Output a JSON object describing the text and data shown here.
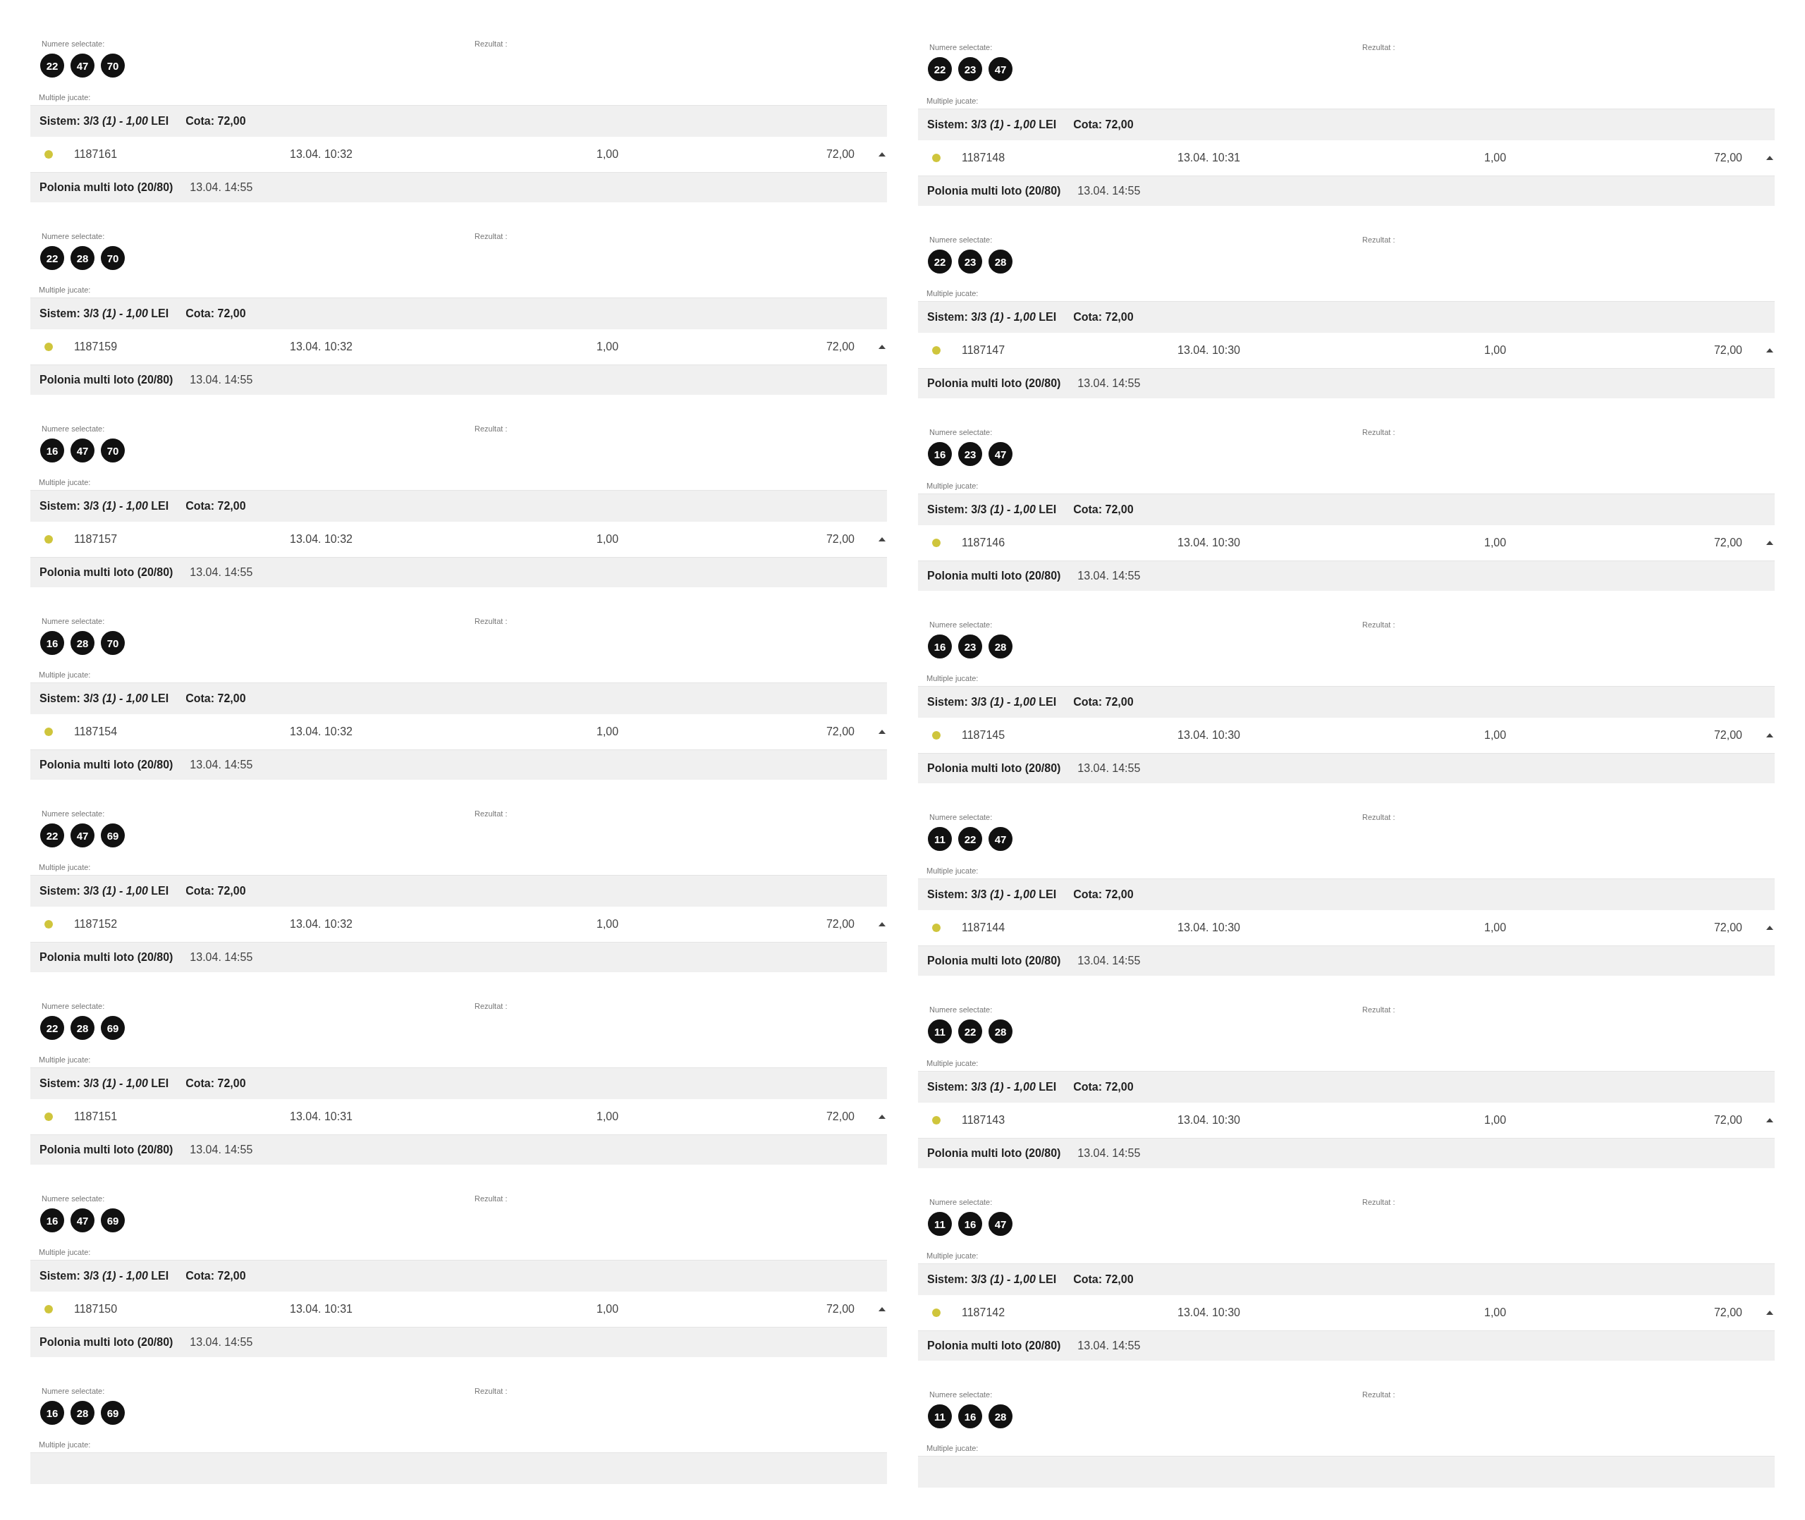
{
  "columns": [
    {
      "tickets": [
        {
          "kind": "full",
          "numbers_label": "Numere selectate:",
          "result_label": "Rezultat :",
          "numbers": [
            "22",
            "47",
            "70"
          ],
          "multiples_label": "Multiple jucate:",
          "system": "Sistem: 3/3 *(1) - 1,00* LEI",
          "odds": "Cota: 72,00",
          "id": "1187161",
          "placed": "13.04. 10:32",
          "stake": "1,00",
          "payout": "72,00",
          "expanded": true,
          "game": "Polonia multi loto (20/80)",
          "draw_time": "13.04. 14:55"
        },
        {
          "kind": "full",
          "numbers_label": "Numere selectate:",
          "result_label": "Rezultat :",
          "numbers": [
            "22",
            "28",
            "70"
          ],
          "multiples_label": "Multiple jucate:",
          "system": "Sistem: 3/3 *(1) - 1,00* LEI",
          "odds": "Cota: 72,00",
          "id": "1187159",
          "placed": "13.04. 10:32",
          "stake": "1,00",
          "payout": "72,00",
          "expanded": true,
          "game": "Polonia multi loto (20/80)",
          "draw_time": "13.04. 14:55"
        },
        {
          "kind": "full",
          "numbers_label": "Numere selectate:",
          "result_label": "Rezultat :",
          "numbers": [
            "16",
            "47",
            "70"
          ],
          "multiples_label": "Multiple jucate:",
          "system": "Sistem: 3/3 *(1) - 1,00* LEI",
          "odds": "Cota: 72,00",
          "id": "1187157",
          "placed": "13.04. 10:32",
          "stake": "1,00",
          "payout": "72,00",
          "expanded": true,
          "game": "Polonia multi loto (20/80)",
          "draw_time": "13.04. 14:55"
        },
        {
          "kind": "full",
          "numbers_label": "Numere selectate:",
          "result_label": "Rezultat :",
          "numbers": [
            "16",
            "28",
            "70"
          ],
          "multiples_label": "Multiple jucate:",
          "system": "Sistem: 3/3 *(1) - 1,00* LEI",
          "odds": "Cota: 72,00",
          "id": "1187154",
          "placed": "13.04. 10:32",
          "stake": "1,00",
          "payout": "72,00",
          "expanded": true,
          "game": "Polonia multi loto (20/80)",
          "draw_time": "13.04. 14:55"
        },
        {
          "kind": "full",
          "numbers_label": "Numere selectate:",
          "result_label": "Rezultat :",
          "numbers": [
            "22",
            "47",
            "69"
          ],
          "multiples_label": "Multiple jucate:",
          "system": "Sistem: 3/3 *(1) - 1,00* LEI",
          "odds": "Cota: 72,00",
          "id": "1187152",
          "placed": "13.04. 10:32",
          "stake": "1,00",
          "payout": "72,00",
          "expanded": true,
          "game": "Polonia multi loto (20/80)",
          "draw_time": "13.04. 14:55"
        },
        {
          "kind": "full",
          "numbers_label": "Numere selectate:",
          "result_label": "Rezultat :",
          "numbers": [
            "22",
            "28",
            "69"
          ],
          "multiples_label": "Multiple jucate:",
          "system": "Sistem: 3/3 *(1) - 1,00* LEI",
          "odds": "Cota: 72,00",
          "id": "1187151",
          "placed": "13.04. 10:31",
          "stake": "1,00",
          "payout": "72,00",
          "expanded": true,
          "game": "Polonia multi loto (20/80)",
          "draw_time": "13.04. 14:55"
        },
        {
          "kind": "full",
          "numbers_label": "Numere selectate:",
          "result_label": "Rezultat :",
          "numbers": [
            "16",
            "47",
            "69"
          ],
          "multiples_label": "Multiple jucate:",
          "system": "Sistem: 3/3 *(1) - 1,00* LEI",
          "odds": "Cota: 72,00",
          "id": "1187150",
          "placed": "13.04. 10:31",
          "stake": "1,00",
          "payout": "72,00",
          "expanded": true,
          "game": "Polonia multi loto (20/80)",
          "draw_time": "13.04. 14:55"
        },
        {
          "kind": "partial",
          "numbers_label": "Numere selectate:",
          "result_label": "Rezultat :",
          "numbers": [
            "16",
            "28",
            "69"
          ],
          "multiples_label": "Multiple jucate:"
        }
      ]
    },
    {
      "tickets": [
        {
          "kind": "full",
          "numbers_label": "Numere selectate:",
          "result_label": "Rezultat :",
          "numbers": [
            "22",
            "23",
            "47"
          ],
          "multiples_label": "Multiple jucate:",
          "system": "Sistem: 3/3 *(1) - 1,00* LEI",
          "odds": "Cota: 72,00",
          "id": "1187148",
          "placed": "13.04. 10:31",
          "stake": "1,00",
          "payout": "72,00",
          "expanded": true,
          "game": "Polonia multi loto (20/80)",
          "draw_time": "13.04. 14:55"
        },
        {
          "kind": "full",
          "numbers_label": "Numere selectate:",
          "result_label": "Rezultat :",
          "numbers": [
            "22",
            "23",
            "28"
          ],
          "multiples_label": "Multiple jucate:",
          "system": "Sistem: 3/3 *(1) - 1,00* LEI",
          "odds": "Cota: 72,00",
          "id": "1187147",
          "placed": "13.04. 10:30",
          "stake": "1,00",
          "payout": "72,00",
          "expanded": true,
          "game": "Polonia multi loto (20/80)",
          "draw_time": "13.04. 14:55"
        },
        {
          "kind": "full",
          "numbers_label": "Numere selectate:",
          "result_label": "Rezultat :",
          "numbers": [
            "16",
            "23",
            "47"
          ],
          "multiples_label": "Multiple jucate:",
          "system": "Sistem: 3/3 *(1) - 1,00* LEI",
          "odds": "Cota: 72,00",
          "id": "1187146",
          "placed": "13.04. 10:30",
          "stake": "1,00",
          "payout": "72,00",
          "expanded": true,
          "game": "Polonia multi loto (20/80)",
          "draw_time": "13.04. 14:55"
        },
        {
          "kind": "full",
          "numbers_label": "Numere selectate:",
          "result_label": "Rezultat :",
          "numbers": [
            "16",
            "23",
            "28"
          ],
          "multiples_label": "Multiple jucate:",
          "system": "Sistem: 3/3 *(1) - 1,00* LEI",
          "odds": "Cota: 72,00",
          "id": "1187145",
          "placed": "13.04. 10:30",
          "stake": "1,00",
          "payout": "72,00",
          "expanded": true,
          "game": "Polonia multi loto (20/80)",
          "draw_time": "13.04. 14:55"
        },
        {
          "kind": "full",
          "numbers_label": "Numere selectate:",
          "result_label": "Rezultat :",
          "numbers": [
            "11",
            "22",
            "47"
          ],
          "multiples_label": "Multiple jucate:",
          "system": "Sistem: 3/3 *(1) - 1,00* LEI",
          "odds": "Cota: 72,00",
          "id": "1187144",
          "placed": "13.04. 10:30",
          "stake": "1,00",
          "payout": "72,00",
          "expanded": true,
          "game": "Polonia multi loto (20/80)",
          "draw_time": "13.04. 14:55"
        },
        {
          "kind": "full",
          "numbers_label": "Numere selectate:",
          "result_label": "Rezultat :",
          "numbers": [
            "11",
            "22",
            "28"
          ],
          "multiples_label": "Multiple jucate:",
          "system": "Sistem: 3/3 *(1) - 1,00* LEI",
          "odds": "Cota: 72,00",
          "id": "1187143",
          "placed": "13.04. 10:30",
          "stake": "1,00",
          "payout": "72,00",
          "expanded": true,
          "game": "Polonia multi loto (20/80)",
          "draw_time": "13.04. 14:55"
        },
        {
          "kind": "full",
          "numbers_label": "Numere selectate:",
          "result_label": "Rezultat :",
          "numbers": [
            "11",
            "16",
            "47"
          ],
          "multiples_label": "Multiple jucate:",
          "system": "Sistem: 3/3 *(1) - 1,00* LEI",
          "odds": "Cota: 72,00",
          "id": "1187142",
          "placed": "13.04. 10:30",
          "stake": "1,00",
          "payout": "72,00",
          "expanded": true,
          "game": "Polonia multi loto (20/80)",
          "draw_time": "13.04. 14:55"
        },
        {
          "kind": "partial",
          "numbers_label": "Numere selectate:",
          "result_label": "Rezultat :",
          "numbers": [
            "11",
            "16",
            "28"
          ],
          "multiples_label": "Multiple jucate:"
        }
      ]
    }
  ]
}
